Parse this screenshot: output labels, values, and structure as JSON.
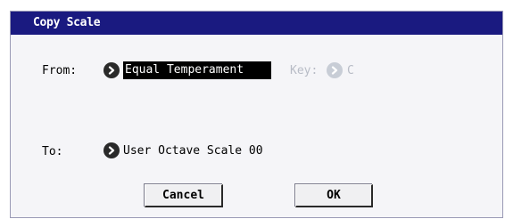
{
  "dialog": {
    "title": "Copy Scale"
  },
  "from": {
    "label": "From:",
    "value": "Equal Temperament",
    "icon": "chevron-right-icon"
  },
  "key": {
    "label": "Key:",
    "value": "C",
    "enabled": false,
    "icon": "chevron-right-icon"
  },
  "to": {
    "label": "To:",
    "value": "User Octave Scale 00",
    "icon": "chevron-right-icon"
  },
  "buttons": {
    "cancel_label": "Cancel",
    "ok_label": "OK"
  },
  "colors": {
    "titlebar": "#1a1a80",
    "selected_bg": "#000000",
    "disabled": "#b8bcc6"
  }
}
